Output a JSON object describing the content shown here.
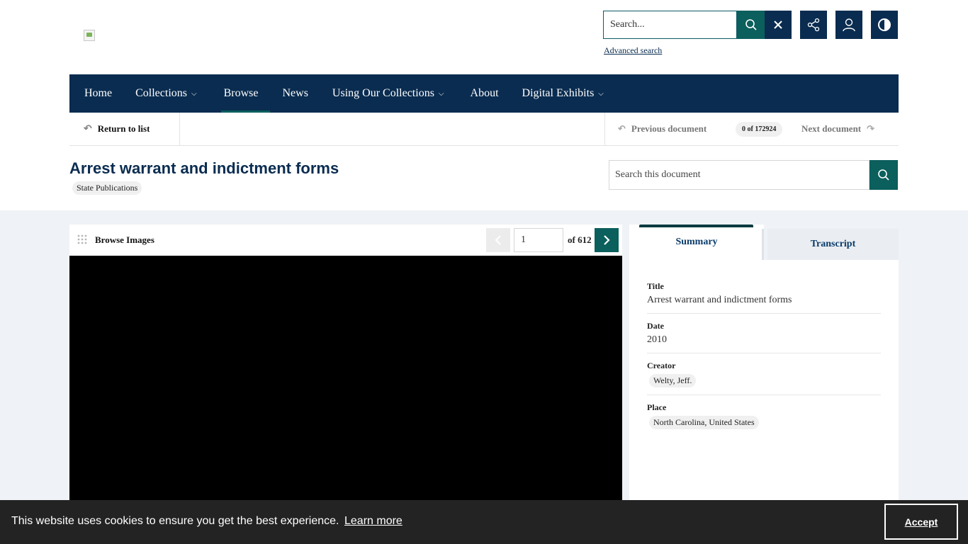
{
  "header": {
    "logo_icon": "broken-image-icon",
    "search_placeholder": "Search...",
    "advanced_search": "Advanced search",
    "icons": [
      "search-icon",
      "close-icon",
      "share-icon",
      "user-icon",
      "contrast-icon"
    ]
  },
  "nav": {
    "items": [
      {
        "label": "Home",
        "dropdown": false
      },
      {
        "label": "Collections",
        "dropdown": true
      },
      {
        "label": "Browse",
        "dropdown": false,
        "active": true
      },
      {
        "label": "News",
        "dropdown": false
      },
      {
        "label": "Using Our Collections",
        "dropdown": true
      },
      {
        "label": "About",
        "dropdown": false
      },
      {
        "label": "Digital Exhibits",
        "dropdown": true
      }
    ]
  },
  "doc_bar": {
    "return_label": "Return to list",
    "previous_label": "Previous document",
    "count": "0 of 172924",
    "next_label": "Next document"
  },
  "document": {
    "title": "Arrest warrant and indictment forms",
    "collection_tag": "State Publications",
    "search_placeholder": "Search this document"
  },
  "viewer": {
    "label": "Browse Images",
    "page_value": "1",
    "page_total": "of 612"
  },
  "panel": {
    "tabs": [
      "Summary",
      "Transcript"
    ],
    "active_tab": "Summary",
    "fields": {
      "title_label": "Title",
      "title_value": "Arrest warrant and indictment forms",
      "date_label": "Date",
      "date_value": "2010",
      "creator_label": "Creator",
      "creator_value": "Welty, Jeff.",
      "place_label": "Place",
      "place_value": "North Carolina, United States"
    }
  },
  "cookie": {
    "message": "This website uses cookies to ensure you get the best experience.",
    "learn_more": "Learn more",
    "accept": "Accept"
  },
  "colors": {
    "navy": "#0a2c50",
    "teal": "#0b5f5c",
    "content_bg": "#eff2f6",
    "cookie_bg": "#232323"
  }
}
